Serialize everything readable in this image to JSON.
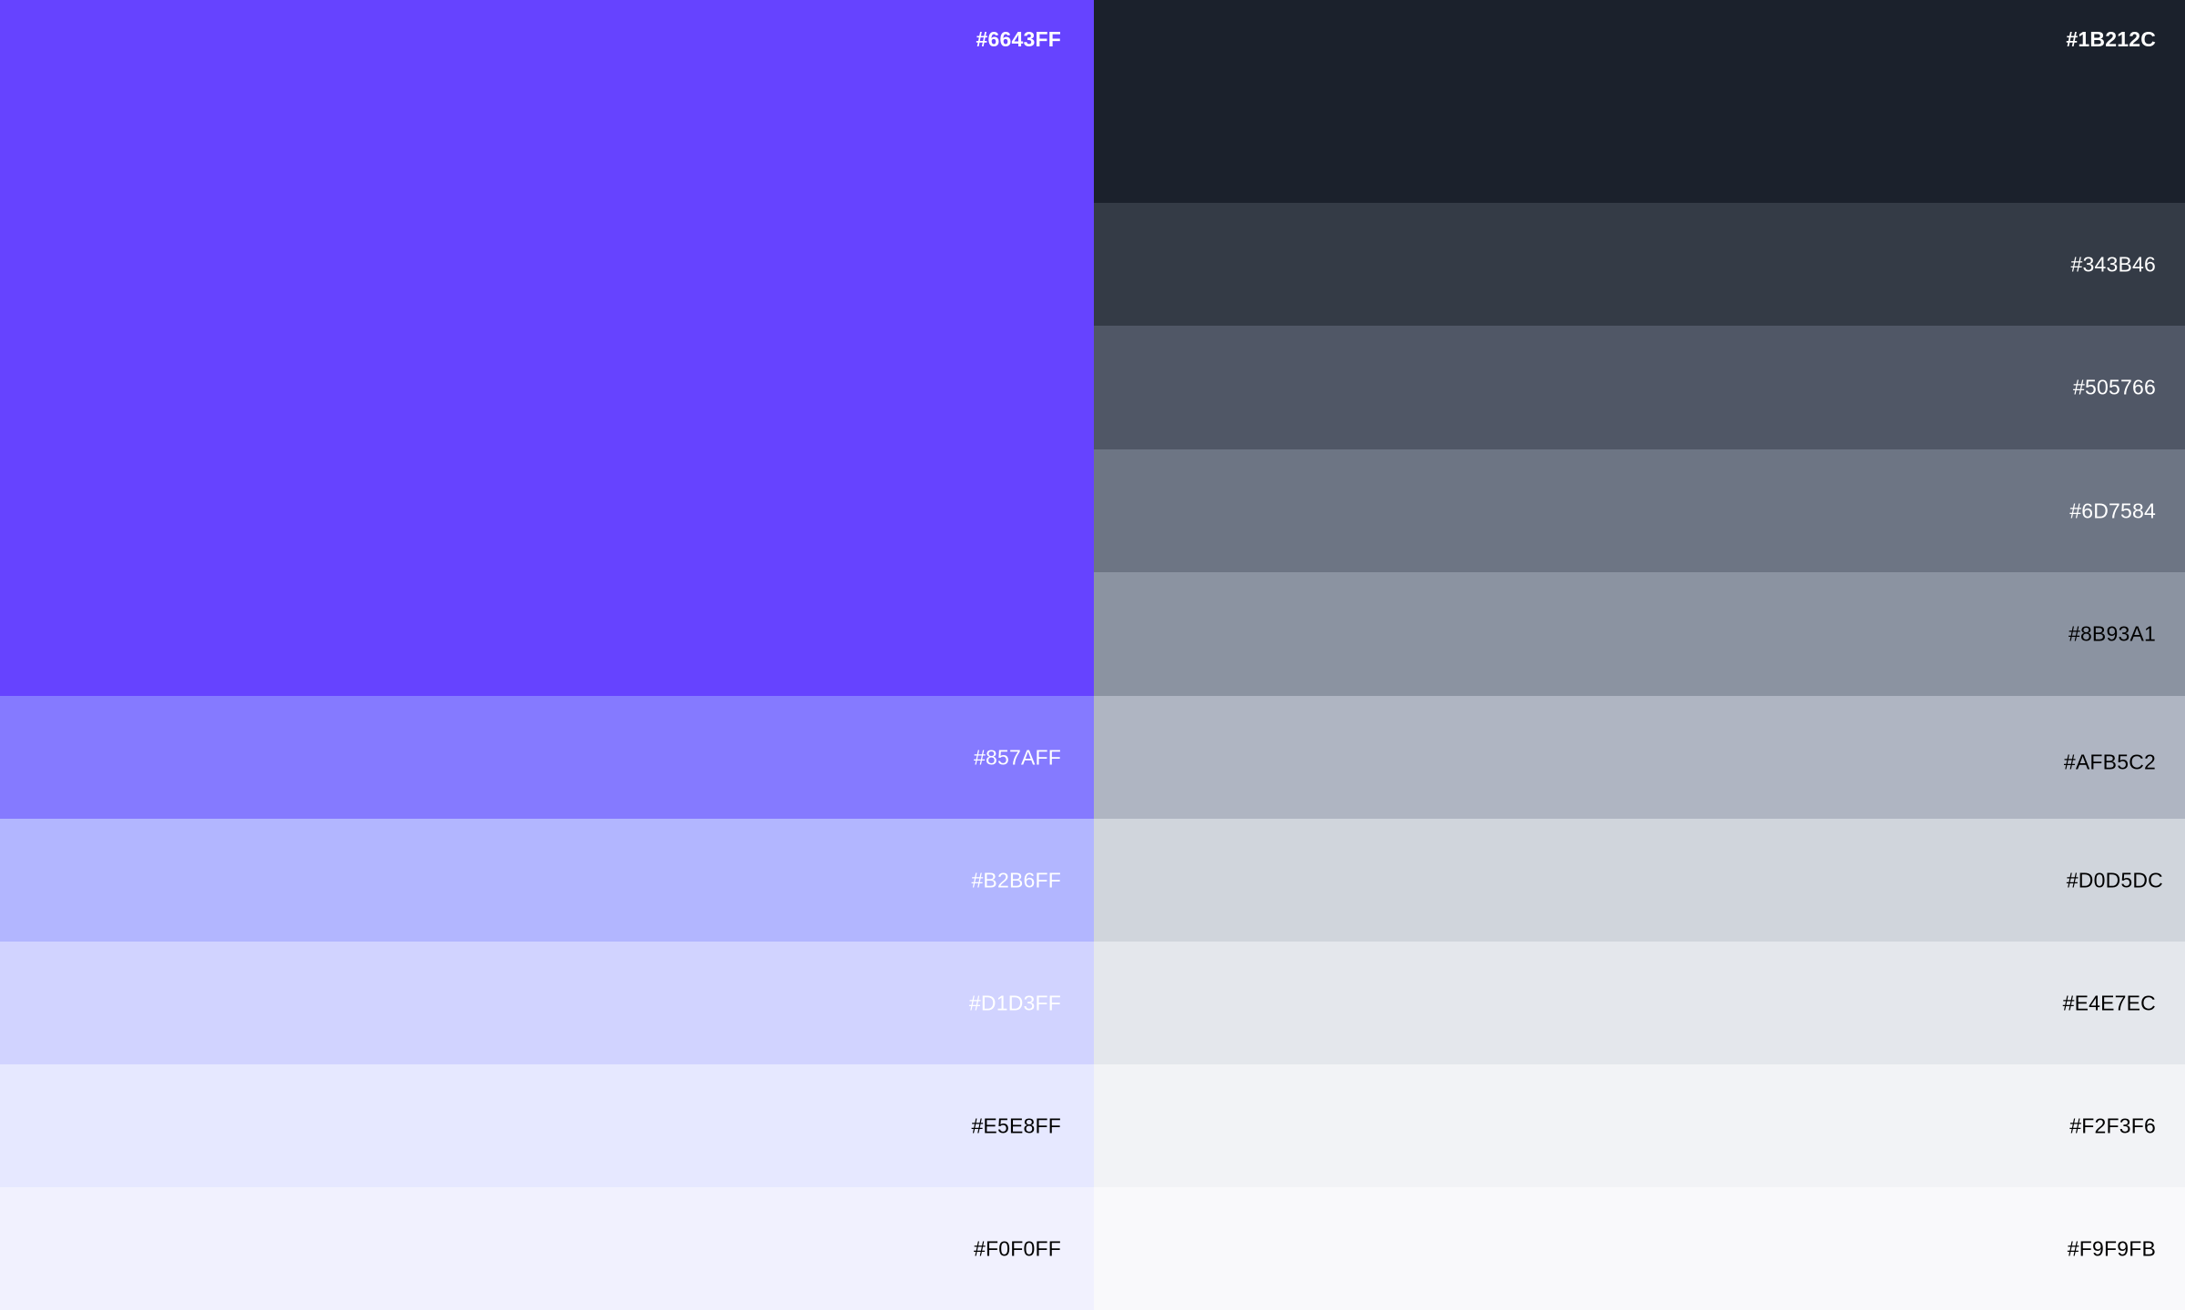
{
  "primary": [
    {
      "hex": "#6643FF",
      "color": "#6643FF",
      "text_color": "#FFFFFF"
    },
    {
      "hex": "#857AFF",
      "color": "#857AFF",
      "text_color": "#FFFFFF"
    },
    {
      "hex": "#B2B6FF",
      "color": "#B2B6FF",
      "text_color": "#FFFFFF"
    },
    {
      "hex": "#D1D3FF",
      "color": "#D1D3FF",
      "text_color": "#FFFFFF"
    },
    {
      "hex": "#E5E8FF",
      "color": "#E6E8FF",
      "text_color": "#000000"
    },
    {
      "hex": "#F0F0FF",
      "color": "#F1F1FE",
      "text_color": "#000000"
    }
  ],
  "neutral": [
    {
      "hex": "#1B212C",
      "color": "#1B212C",
      "text_color": "#FFFFFF"
    },
    {
      "hex": "#343B46",
      "color": "#343B46",
      "text_color": "#FFFFFF"
    },
    {
      "hex": "#505766",
      "color": "#505766",
      "text_color": "#FFFFFF"
    },
    {
      "hex": "#6D7584",
      "color": "#6D7584",
      "text_color": "#FFFFFF"
    },
    {
      "hex": "#8B93A1",
      "color": "#8B93A1",
      "text_color": "#000000"
    },
    {
      "hex": "#AFB5C2",
      "color": "#AFB5C2",
      "text_color": "#000000"
    },
    {
      "hex": "#D0D5DC",
      "color": "#D0D5DC",
      "text_color": "#000000"
    },
    {
      "hex": "#E4E7EC",
      "color": "#E4E7EC",
      "text_color": "#000000"
    },
    {
      "hex": "#F2F3F6",
      "color": "#F2F3F6",
      "text_color": "#000000"
    },
    {
      "hex": "#F9F9FB",
      "color": "#F9F9FB",
      "text_color": "#000000"
    }
  ]
}
